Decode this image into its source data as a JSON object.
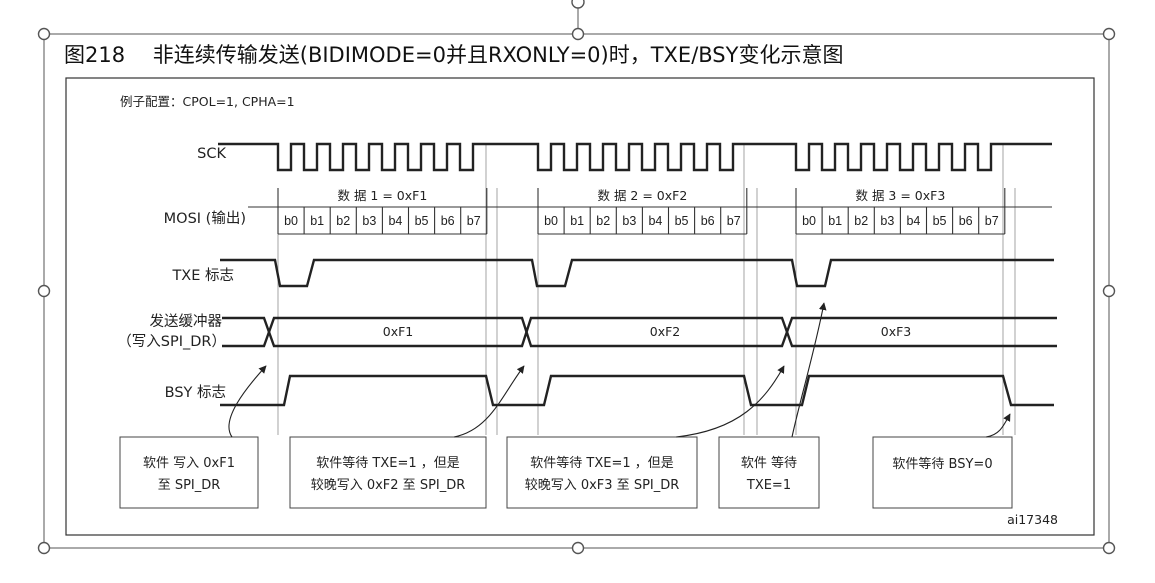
{
  "figure": {
    "title": "图218　 非连续传输发送(BIDIMODE=0并且RXONLY=0)时，TXE/BSY变化示意图",
    "config": "例子配置：CPOL=1, CPHA=1",
    "id": "ai17348"
  },
  "signals": {
    "sck": "SCK",
    "mosi": "MOSI (输出)",
    "txe": "TXE 标志",
    "buffer_line1": "发送缓冲器",
    "buffer_line2": "（写入SPI_DR）",
    "bsy": "BSY 标志"
  },
  "data_labels": [
    "数 据 1 = 0xF1",
    "数 据 2 = 0xF2",
    "数 据 3 = 0xF3"
  ],
  "bits": [
    "b0",
    "b1",
    "b2",
    "b3",
    "b4",
    "b5",
    "b6",
    "b7"
  ],
  "buffer_values": [
    "0xF1",
    "0xF2",
    "0xF3"
  ],
  "notes": [
    {
      "l1": "软件 写入 0xF1",
      "l2": "至 SPI_DR"
    },
    {
      "l1": "软件等待 TXE=1 ，但是",
      "l2": "较晚写入 0xF2 至 SPI_DR"
    },
    {
      "l1": "软件等待 TXE=1 ，但是",
      "l2": "较晚写入 0xF3 至 SPI_DR"
    },
    {
      "l1": "软件 等待",
      "l2": "TXE=1"
    },
    {
      "l1": "软件等待 BSY=0",
      "l2": ""
    }
  ],
  "colors": {
    "line": "#222222",
    "frame": "#333333",
    "handle": "#555555"
  }
}
